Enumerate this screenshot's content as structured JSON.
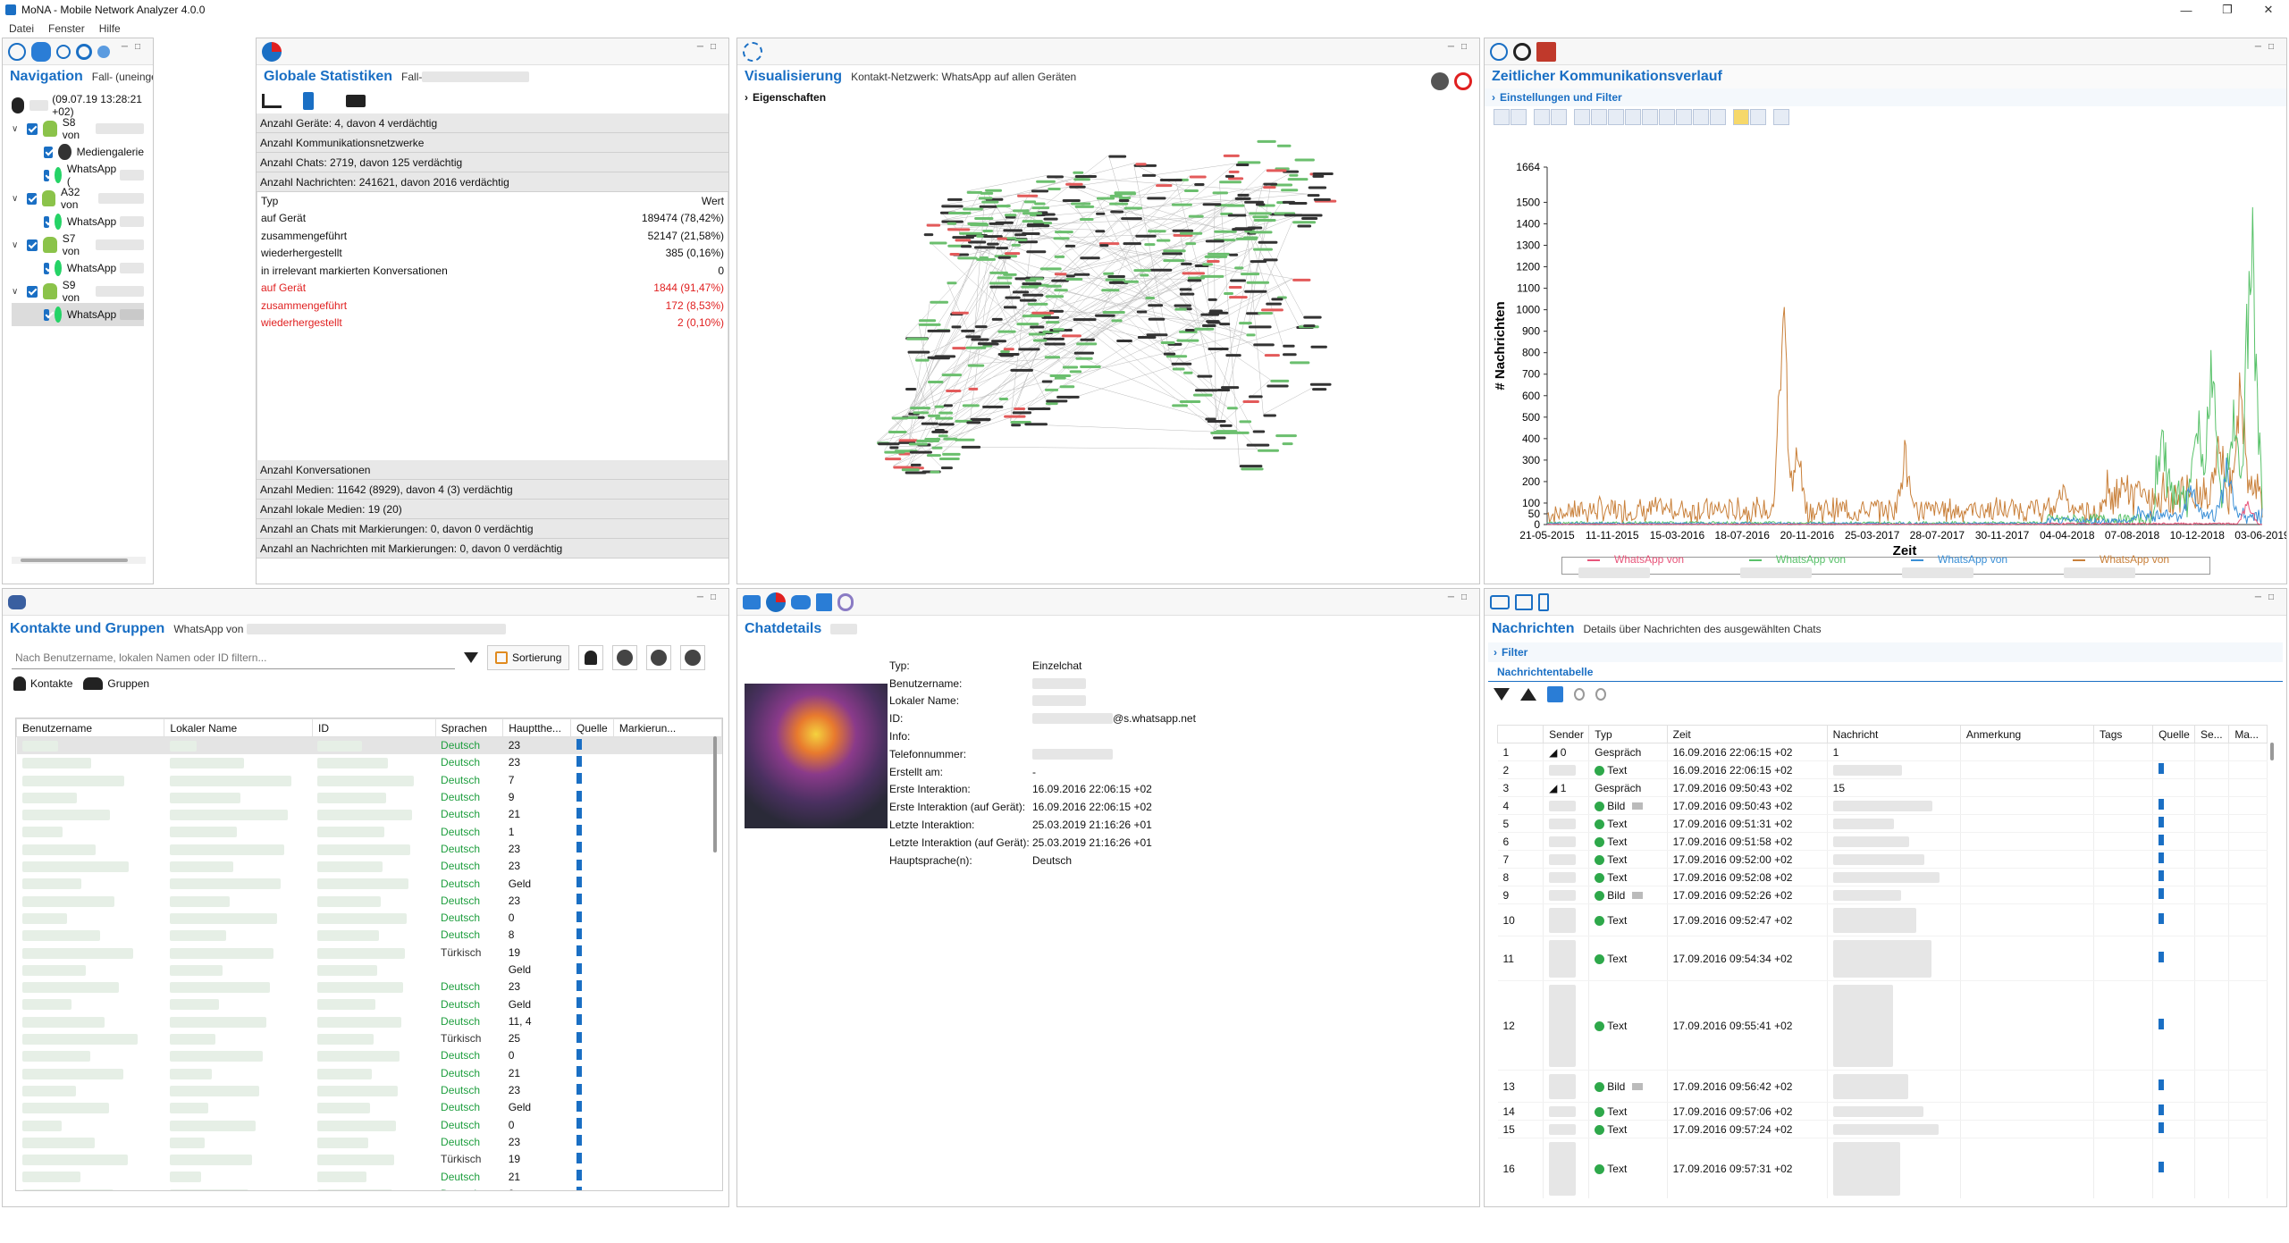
{
  "window": {
    "title": "MoNA - Mobile Network Analyzer 4.0.0"
  },
  "menu": [
    "Datei",
    "Fenster",
    "Hilfe"
  ],
  "navigation": {
    "title": "Navigation",
    "case_label": "Fall-",
    "case_suffix": "(uneingeschränkt)",
    "root_date": "(09.07.19 13:28:21 +02)",
    "devices": [
      {
        "name": "S8 von",
        "apps": [
          "Mediengalerie",
          "WhatsApp ("
        ]
      },
      {
        "name": "A32 von",
        "apps": [
          "WhatsApp"
        ]
      },
      {
        "name": "S7 von",
        "apps": [
          "WhatsApp"
        ]
      },
      {
        "name": "S9 von",
        "apps": [
          "WhatsApp"
        ]
      }
    ]
  },
  "stats": {
    "title": "Globale Statistiken",
    "case_label": "Fall-",
    "bars_top": [
      "Anzahl Geräte: 4, davon 4 verdächtig",
      "Anzahl Kommunikationsnetzwerke",
      "Anzahl Chats: 2719, davon 125 verdächtig",
      "Anzahl Nachrichten: 241621, davon 2016 verdächtig"
    ],
    "table_header": {
      "type": "Typ",
      "value": "Wert"
    },
    "rows": [
      {
        "label": "auf Gerät",
        "value": "189474 (78,42%)",
        "red": false
      },
      {
        "label": "zusammengeführt",
        "value": "52147 (21,58%)",
        "red": false
      },
      {
        "label": "wiederhergestellt",
        "value": "385 (0,16%)",
        "red": false
      },
      {
        "label": "in irrelevant markierten Konversationen",
        "value": "0",
        "red": false
      },
      {
        "label": "auf Gerät",
        "value": "1844 (91,47%)",
        "red": true
      },
      {
        "label": "zusammengeführt",
        "value": "172 (8,53%)",
        "red": true
      },
      {
        "label": "wiederhergestellt",
        "value": "2 (0,10%)",
        "red": true
      }
    ],
    "bars_bottom": [
      "Anzahl Konversationen",
      "Anzahl Medien: 11642 (8929), davon 4 (3) verdächtig",
      "Anzahl lokale Medien: 19 (20)",
      "Anzahl an Chats mit Markierungen: 0, davon 0 verdächtig",
      "Anzahl an Nachrichten mit Markierungen: 0, davon 0 verdächtig"
    ]
  },
  "visual": {
    "title": "Visualisierung",
    "subtitle": "Kontakt-Netzwerk: WhatsApp auf allen Geräten",
    "properties": "Eigenschaften"
  },
  "timeline": {
    "title": "Zeitlicher Kommunikationsverlauf",
    "settings": "Einstellungen und Filter",
    "legend": [
      "WhatsApp von",
      "WhatsApp von",
      "WhatsApp von",
      "WhatsApp von"
    ],
    "legend_colors": [
      "#e8557a",
      "#59c26a",
      "#3a8fd6",
      "#c9803a"
    ]
  },
  "chart_data": {
    "type": "line",
    "title": "",
    "xlabel": "Zeit",
    "ylabel": "# Nachrichten",
    "ylim": [
      0,
      1664
    ],
    "yticks": [
      0,
      50,
      100,
      200,
      300,
      400,
      500,
      600,
      700,
      800,
      900,
      1000,
      1100,
      1200,
      1300,
      1400,
      1500,
      1664
    ],
    "xticks": [
      "21-05-2015",
      "11-11-2015",
      "15-03-2016",
      "18-07-2016",
      "20-11-2016",
      "25-03-2017",
      "28-07-2017",
      "30-11-2017",
      "04-04-2018",
      "07-08-2018",
      "10-12-2018",
      "03-06-2019"
    ],
    "series": [
      {
        "name": "WhatsApp von",
        "color": "#c9803a",
        "peaks": [
          [
            0.33,
            1280
          ],
          [
            0.35,
            450
          ],
          [
            0.5,
            420
          ],
          [
            0.72,
            230
          ],
          [
            0.94,
            420
          ],
          [
            0.97,
            780
          ]
        ],
        "base": 60
      },
      {
        "name": "WhatsApp von",
        "color": "#59c26a",
        "peaks": [
          [
            0.86,
            380
          ],
          [
            0.91,
            480
          ],
          [
            0.93,
            800
          ],
          [
            0.96,
            480
          ],
          [
            0.985,
            1560
          ]
        ],
        "base": 30
      },
      {
        "name": "WhatsApp von",
        "color": "#3a8fd6",
        "peaks": [
          [
            0.9,
            200
          ],
          [
            0.95,
            280
          ]
        ],
        "base": 20
      },
      {
        "name": "WhatsApp von",
        "color": "#e8557a",
        "peaks": [
          [
            0.98,
            120
          ]
        ],
        "base": 5
      }
    ]
  },
  "contacts": {
    "title": "Kontakte und Gruppen",
    "subtitle": "WhatsApp von",
    "search_placeholder": "Nach Benutzername, lokalen Namen oder ID filtern...",
    "sort_label": "Sortierung",
    "tab_contacts": "Kontakte",
    "tab_groups": "Gruppen",
    "columns": [
      "Benutzername",
      "Lokaler Name",
      "ID",
      "Sprachen",
      "Hauptthe...",
      "Quelle",
      "Markierun..."
    ],
    "rows": [
      {
        "lang": "Deutsch",
        "topic": "23"
      },
      {
        "lang": "Deutsch",
        "topic": "23"
      },
      {
        "lang": "Deutsch",
        "topic": "7"
      },
      {
        "lang": "Deutsch",
        "topic": "9"
      },
      {
        "lang": "Deutsch",
        "topic": "21"
      },
      {
        "lang": "Deutsch",
        "topic": "1"
      },
      {
        "lang": "Deutsch",
        "topic": "23"
      },
      {
        "lang": "Deutsch",
        "topic": "23"
      },
      {
        "lang": "Deutsch",
        "topic": "Geld"
      },
      {
        "lang": "Deutsch",
        "topic": "23"
      },
      {
        "lang": "Deutsch",
        "topic": "0"
      },
      {
        "lang": "Deutsch",
        "topic": "8"
      },
      {
        "lang": "Türkisch",
        "topic": "19"
      },
      {
        "lang": "",
        "topic": "Geld"
      },
      {
        "lang": "Deutsch",
        "topic": "23"
      },
      {
        "lang": "Deutsch",
        "topic": "Geld"
      },
      {
        "lang": "Deutsch",
        "topic": "11, 4"
      },
      {
        "lang": "Türkisch",
        "topic": "25"
      },
      {
        "lang": "Deutsch",
        "topic": "0"
      },
      {
        "lang": "Deutsch",
        "topic": "21"
      },
      {
        "lang": "Deutsch",
        "topic": "23"
      },
      {
        "lang": "Deutsch",
        "topic": "Geld"
      },
      {
        "lang": "Deutsch",
        "topic": "0"
      },
      {
        "lang": "Deutsch",
        "topic": "23"
      },
      {
        "lang": "Türkisch",
        "topic": "19"
      },
      {
        "lang": "Deutsch",
        "topic": "21"
      },
      {
        "lang": "Deutsch",
        "topic": "8"
      }
    ]
  },
  "chatdetails": {
    "title": "Chatdetails",
    "fields": [
      {
        "label": "Typ:",
        "value": "Einzelchat"
      },
      {
        "label": "Benutzername:",
        "value": ""
      },
      {
        "label": "Lokaler Name:",
        "value": ""
      },
      {
        "label": "ID:",
        "value": "@s.whatsapp.net"
      },
      {
        "label": "Info:",
        "value": ""
      },
      {
        "label": "Telefonnummer:",
        "value": ""
      },
      {
        "label": "Erstellt am:",
        "value": "-"
      },
      {
        "label": "Erste Interaktion:",
        "value": "16.09.2016 22:06:15 +02"
      },
      {
        "label": "Erste Interaktion (auf Gerät):",
        "value": "16.09.2016 22:06:15 +02"
      },
      {
        "label": "Letzte Interaktion:",
        "value": "25.03.2019 21:16:26 +01"
      },
      {
        "label": "Letzte Interaktion (auf Gerät):",
        "value": "25.03.2019 21:16:26 +01"
      },
      {
        "label": "Hauptsprache(n):",
        "value": "Deutsch"
      }
    ]
  },
  "messages": {
    "title": "Nachrichten",
    "subtitle": "Details über Nachrichten des ausgewählten Chats",
    "filter": "Filter",
    "table_title": "Nachrichtentabelle",
    "columns": [
      "",
      "Sender",
      "Typ",
      "Zeit",
      "Nachricht",
      "Anmerkung",
      "Tags",
      "Quelle",
      "Se...",
      "Ma..."
    ],
    "rows": [
      {
        "n": "1",
        "tree": "◢ 0",
        "type": "Gespräch",
        "time": "16.09.2016 22:06:15 +02",
        "msg": "1",
        "dot": false,
        "h": 20
      },
      {
        "n": "2",
        "tree": "",
        "type": "Text",
        "time": "16.09.2016 22:06:15 +02",
        "msg": "",
        "dot": true,
        "h": 20
      },
      {
        "n": "3",
        "tree": "◢ 1",
        "type": "Gespräch",
        "time": "17.09.2016 09:50:43 +02",
        "msg": "15",
        "dot": false,
        "h": 20
      },
      {
        "n": "4",
        "tree": "",
        "type": "Bild",
        "time": "17.09.2016 09:50:43 +02",
        "msg": "",
        "dot": true,
        "h": 20
      },
      {
        "n": "5",
        "tree": "",
        "type": "Text",
        "time": "17.09.2016 09:51:31 +02",
        "msg": "",
        "dot": true,
        "h": 20
      },
      {
        "n": "6",
        "tree": "",
        "type": "Text",
        "time": "17.09.2016 09:51:58 +02",
        "msg": "",
        "dot": true,
        "h": 20
      },
      {
        "n": "7",
        "tree": "",
        "type": "Text",
        "time": "17.09.2016 09:52:00 +02",
        "msg": "",
        "dot": true,
        "h": 20
      },
      {
        "n": "8",
        "tree": "",
        "type": "Text",
        "time": "17.09.2016 09:52:08 +02",
        "msg": "",
        "dot": true,
        "h": 20
      },
      {
        "n": "9",
        "tree": "",
        "type": "Bild",
        "time": "17.09.2016 09:52:26 +02",
        "msg": "",
        "dot": true,
        "h": 20
      },
      {
        "n": "10",
        "tree": "",
        "type": "Text",
        "time": "17.09.2016 09:52:47 +02",
        "msg": "",
        "dot": true,
        "h": 36
      },
      {
        "n": "11",
        "tree": "",
        "type": "Text",
        "time": "17.09.2016 09:54:34 +02",
        "msg": "",
        "dot": true,
        "h": 50
      },
      {
        "n": "12",
        "tree": "",
        "type": "Text",
        "time": "17.09.2016 09:55:41 +02",
        "msg": "",
        "dot": true,
        "h": 100
      },
      {
        "n": "13",
        "tree": "",
        "type": "Bild",
        "time": "17.09.2016 09:56:42 +02",
        "msg": "",
        "dot": true,
        "h": 36
      },
      {
        "n": "14",
        "tree": "",
        "type": "Text",
        "time": "17.09.2016 09:57:06 +02",
        "msg": "",
        "dot": true,
        "h": 20
      },
      {
        "n": "15",
        "tree": "",
        "type": "Text",
        "time": "17.09.2016 09:57:24 +02",
        "msg": "",
        "dot": true,
        "h": 20
      },
      {
        "n": "16",
        "tree": "",
        "type": "Text",
        "time": "17.09.2016 09:57:31 +02",
        "msg": "",
        "dot": true,
        "h": 68
      }
    ]
  }
}
